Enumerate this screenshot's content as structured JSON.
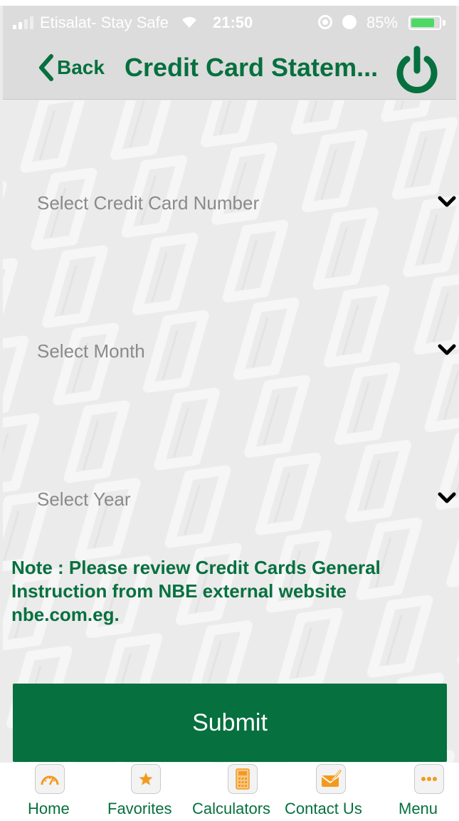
{
  "status_bar": {
    "carrier": "Etisalat- Stay Safe",
    "time": "21:50",
    "battery": "85%",
    "battery_level": 0.85,
    "icons": [
      "signal-icon",
      "wifi-icon",
      "orientation-lock-icon",
      "alarm-icon",
      "battery-icon"
    ]
  },
  "nav": {
    "back_label": "Back",
    "title": "Credit Card Statem...",
    "power_icon": "power-icon"
  },
  "form": {
    "card_number": {
      "placeholder": "Select Credit Card Number"
    },
    "month": {
      "placeholder": "Select Month"
    },
    "year": {
      "placeholder": "Select Year"
    },
    "note": "Note : Please review Credit Cards General Instruction from NBE external website nbe.com.eg.",
    "submit_label": "Submit"
  },
  "tabbar": {
    "items": [
      {
        "label": "Home",
        "icon": "speedometer-icon"
      },
      {
        "label": "Favorites",
        "icon": "star-icon"
      },
      {
        "label": "Calculators",
        "icon": "calculator-icon"
      },
      {
        "label": "Contact Us",
        "icon": "envelope-pen-icon"
      },
      {
        "label": "Menu",
        "icon": "more-dots-icon"
      }
    ]
  },
  "colors": {
    "brand_green": "#06703f",
    "icon_orange": "#f39a1e",
    "background": "#ebebeb",
    "placeholder_grey": "#8a8a8a"
  }
}
